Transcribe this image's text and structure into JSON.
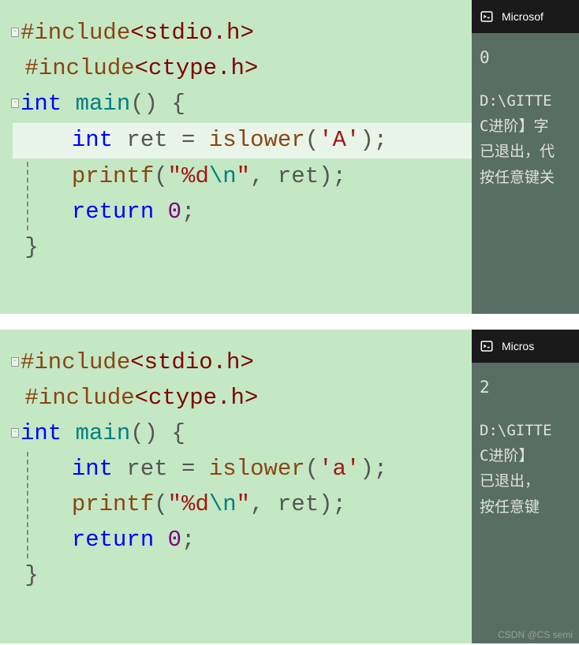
{
  "panel1": {
    "code": {
      "include1_a": "#include",
      "include1_b": "<stdio.h>",
      "include2_a": "#include",
      "include2_b": "<ctype.h>",
      "main_kw": "int",
      "main_nm": " main",
      "main_pn": "() {",
      "decl_kw": "int",
      "decl_id": " ret ",
      "decl_eq": "= ",
      "decl_fn": "islower",
      "decl_op": "(",
      "decl_ch": "'A'",
      "decl_cl": ");",
      "printf_fn": "printf",
      "printf_op": "(",
      "printf_s1": "\"%d",
      "printf_es": "\\n",
      "printf_s2": "\"",
      "printf_cm": ", ",
      "printf_id": "ret",
      "printf_cl": ");",
      "ret_kw": "return",
      "ret_sp": " ",
      "ret_v": "0",
      "ret_sc": ";",
      "close": "}"
    },
    "output": {
      "title": "Microsof",
      "value": "0",
      "line1": "D:\\GITTE",
      "line2": "C进阶】字",
      "line3": "已退出，代",
      "line4": "按任意键关"
    }
  },
  "panel2": {
    "code": {
      "include1_a": "#include",
      "include1_b": "<stdio.h>",
      "include2_a": "#include",
      "include2_b": "<ctype.h>",
      "main_kw": "int",
      "main_nm": " main",
      "main_pn": "() {",
      "decl_kw": "int",
      "decl_id": " ret ",
      "decl_eq": "= ",
      "decl_fn": "islower",
      "decl_op": "(",
      "decl_ch": "'a'",
      "decl_cl": ");",
      "printf_fn": "printf",
      "printf_op": "(",
      "printf_s1": "\"%d",
      "printf_es": "\\n",
      "printf_s2": "\"",
      "printf_cm": ", ",
      "printf_id": "ret",
      "printf_cl": ");",
      "ret_kw": "return",
      "ret_sp": " ",
      "ret_v": "0",
      "ret_sc": ";",
      "close": "}"
    },
    "output": {
      "title": "Micros",
      "value": "2",
      "line1": "D:\\GITTE",
      "line2": "C进阶】",
      "line3": "已退出，",
      "line4": "按任意键"
    }
  },
  "watermark": "CSDN @CS semi"
}
